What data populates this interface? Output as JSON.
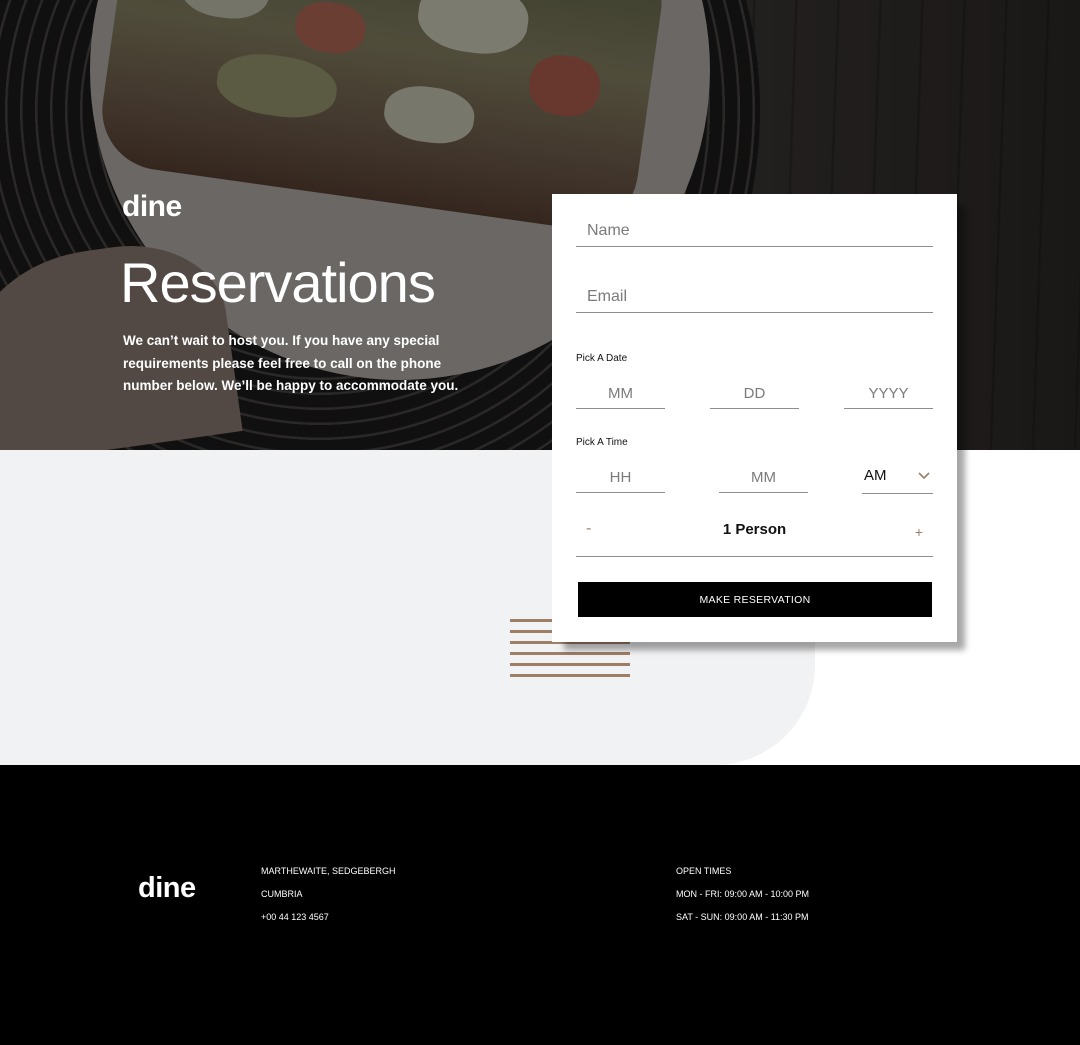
{
  "hero": {
    "logo": "dine",
    "title": "Reservations",
    "description": "We can’t wait to host you. If you have any special requirements please feel free to call on the phone number below. We’ll be happy to accommodate you."
  },
  "form": {
    "name_placeholder": "Name",
    "email_placeholder": "Email",
    "date_label": "Pick A Date",
    "date_month_placeholder": "MM",
    "date_day_placeholder": "DD",
    "date_year_placeholder": "YYYY",
    "time_label": "Pick A Time",
    "time_hour_placeholder": "HH",
    "time_minute_placeholder": "MM",
    "time_period": "AM",
    "decrement_label": "-",
    "increment_label": "+",
    "persons_label": "1 Person",
    "submit_label": "MAKE RESERVATION"
  },
  "footer": {
    "logo": "dine",
    "address_line1": "MARTHEWAITE, SEDGEBERGH",
    "address_line2": "CUMBRIA",
    "phone": "+00 44 123 4567",
    "open_times_title": "OPEN TIMES",
    "weekday_hours": "MON - FRI: 09:00 AM - 10:00 PM",
    "weekend_hours": "SAT - SUN: 09:00 AM - 11:30 PM"
  },
  "colors": {
    "accent": "#9e7f66",
    "footer_bg": "#000000",
    "section_bg": "#f1f2f3"
  },
  "icons": {
    "period_dropdown": "chevron-down-icon"
  }
}
